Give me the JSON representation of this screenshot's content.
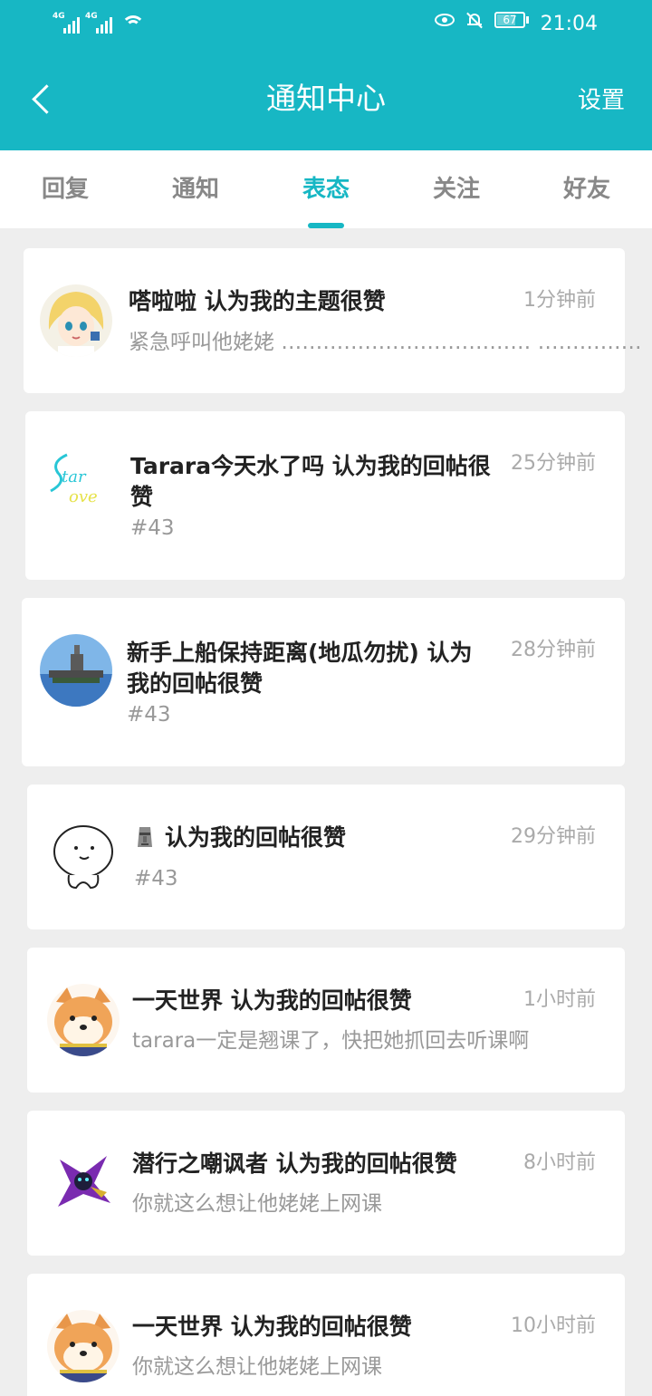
{
  "status_bar": {
    "signal_1": "4G",
    "signal_2": "4G",
    "battery": "67",
    "time": "21:04",
    "icons": [
      "signal-icon",
      "signal-icon",
      "wifi-icon",
      "eye-icon",
      "bell-off-icon",
      "battery-icon"
    ]
  },
  "header": {
    "back_icon": "back-icon",
    "title": "通知中心",
    "settings": "设置"
  },
  "tabs": [
    {
      "label": "回复"
    },
    {
      "label": "通知"
    },
    {
      "label": "表态"
    },
    {
      "label": "关注"
    },
    {
      "label": "好友"
    }
  ],
  "active_tab": "表态",
  "colors": {
    "accent": "#17b7c4",
    "background": "#eeeeee",
    "card": "#ffffff",
    "title": "#222222",
    "muted": "#999999"
  },
  "notifications": [
    {
      "title": "嗒啦啦 认为我的主题很赞",
      "subtitle": "紧急呼叫他姥姥 ……………………………… ……………",
      "time": "1分钟前",
      "avatar": "anime-girl-avatar"
    },
    {
      "title": "Tarara今天水了吗 认为我的回帖很赞",
      "subtitle": "#43",
      "time": "25分钟前",
      "avatar": "star-love-avatar"
    },
    {
      "title": "新手上船保持距离(地瓜勿扰) 认为我的回帖很赞",
      "subtitle": "#43",
      "time": "28分钟前",
      "avatar": "warship-avatar"
    },
    {
      "title": "认为我的回帖很赞",
      "subtitle": "#43",
      "time": "29分钟前",
      "avatar": "blob-avatar",
      "name_icon": "moai-icon"
    },
    {
      "title": "一天世界 认为我的回帖很赞",
      "subtitle": "tarara一定是翘课了，快把她抓回去听课啊",
      "time": "1小时前",
      "avatar": "shiba-avatar"
    },
    {
      "title": "潜行之嘲讽者 认为我的回帖很赞",
      "subtitle": "你就这么想让他姥姥上网课",
      "time": "8小时前",
      "avatar": "purple-character-avatar"
    },
    {
      "title": "一天世界 认为我的回帖很赞",
      "subtitle": "你就这么想让他姥姥上网课",
      "time": "10小时前",
      "avatar": "shiba-avatar"
    }
  ]
}
